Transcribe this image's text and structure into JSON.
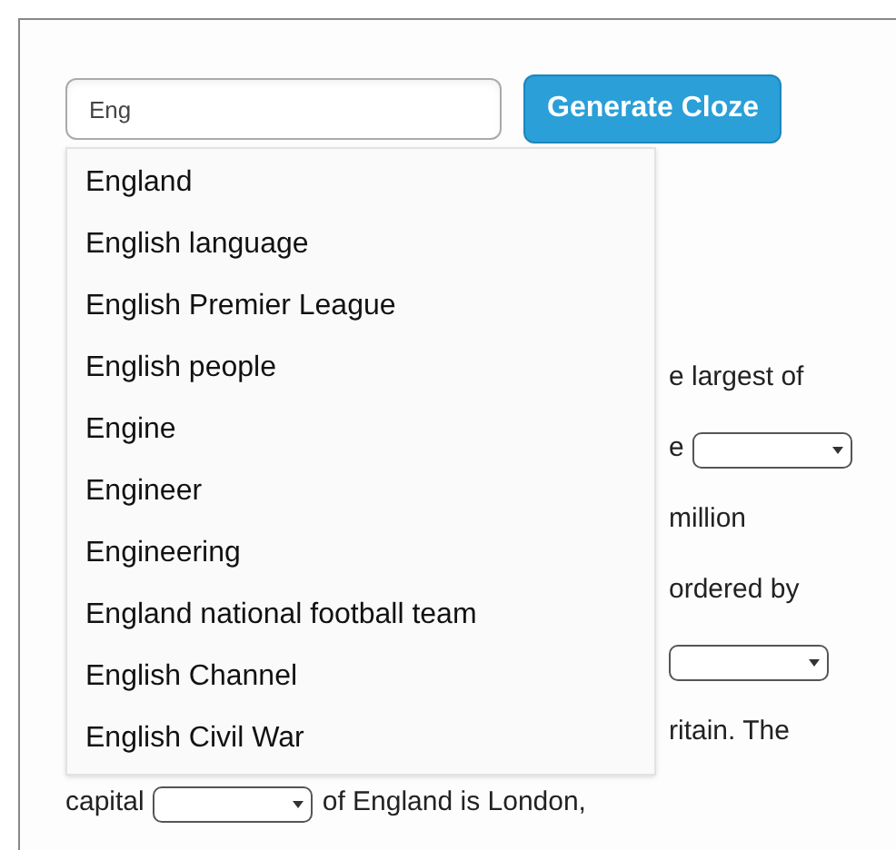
{
  "search": {
    "value": "Eng"
  },
  "button": "Generate Cloze",
  "suggestions": [
    {
      "label": "England"
    },
    {
      "label": "English language"
    },
    {
      "label": "English Premier League"
    },
    {
      "label": "English people"
    },
    {
      "label": "Engine"
    },
    {
      "label": "Engineer"
    },
    {
      "label": "Engineering"
    },
    {
      "label": "England national football team"
    },
    {
      "label": "English Channel"
    },
    {
      "label": "English Civil War"
    }
  ],
  "passage_lines": [
    {
      "parts": [
        {
          "kind": "text",
          "text": "e largest of"
        }
      ]
    },
    {
      "parts": [
        {
          "kind": "text",
          "text": "e"
        },
        {
          "kind": "blank"
        }
      ]
    },
    {
      "parts": [
        {
          "kind": "text",
          "text": "million"
        }
      ]
    },
    {
      "parts": [
        {
          "kind": "text",
          "text": "ordered by"
        }
      ]
    },
    {
      "parts": [
        {
          "kind": "blank"
        }
      ]
    },
    {
      "parts": [
        {
          "kind": "text",
          "text": "ritain. The"
        }
      ]
    },
    {
      "parts": [
        {
          "kind": "text",
          "text": "capital"
        },
        {
          "kind": "blank"
        },
        {
          "kind": "text",
          "text": "of England is London,"
        }
      ]
    }
  ]
}
